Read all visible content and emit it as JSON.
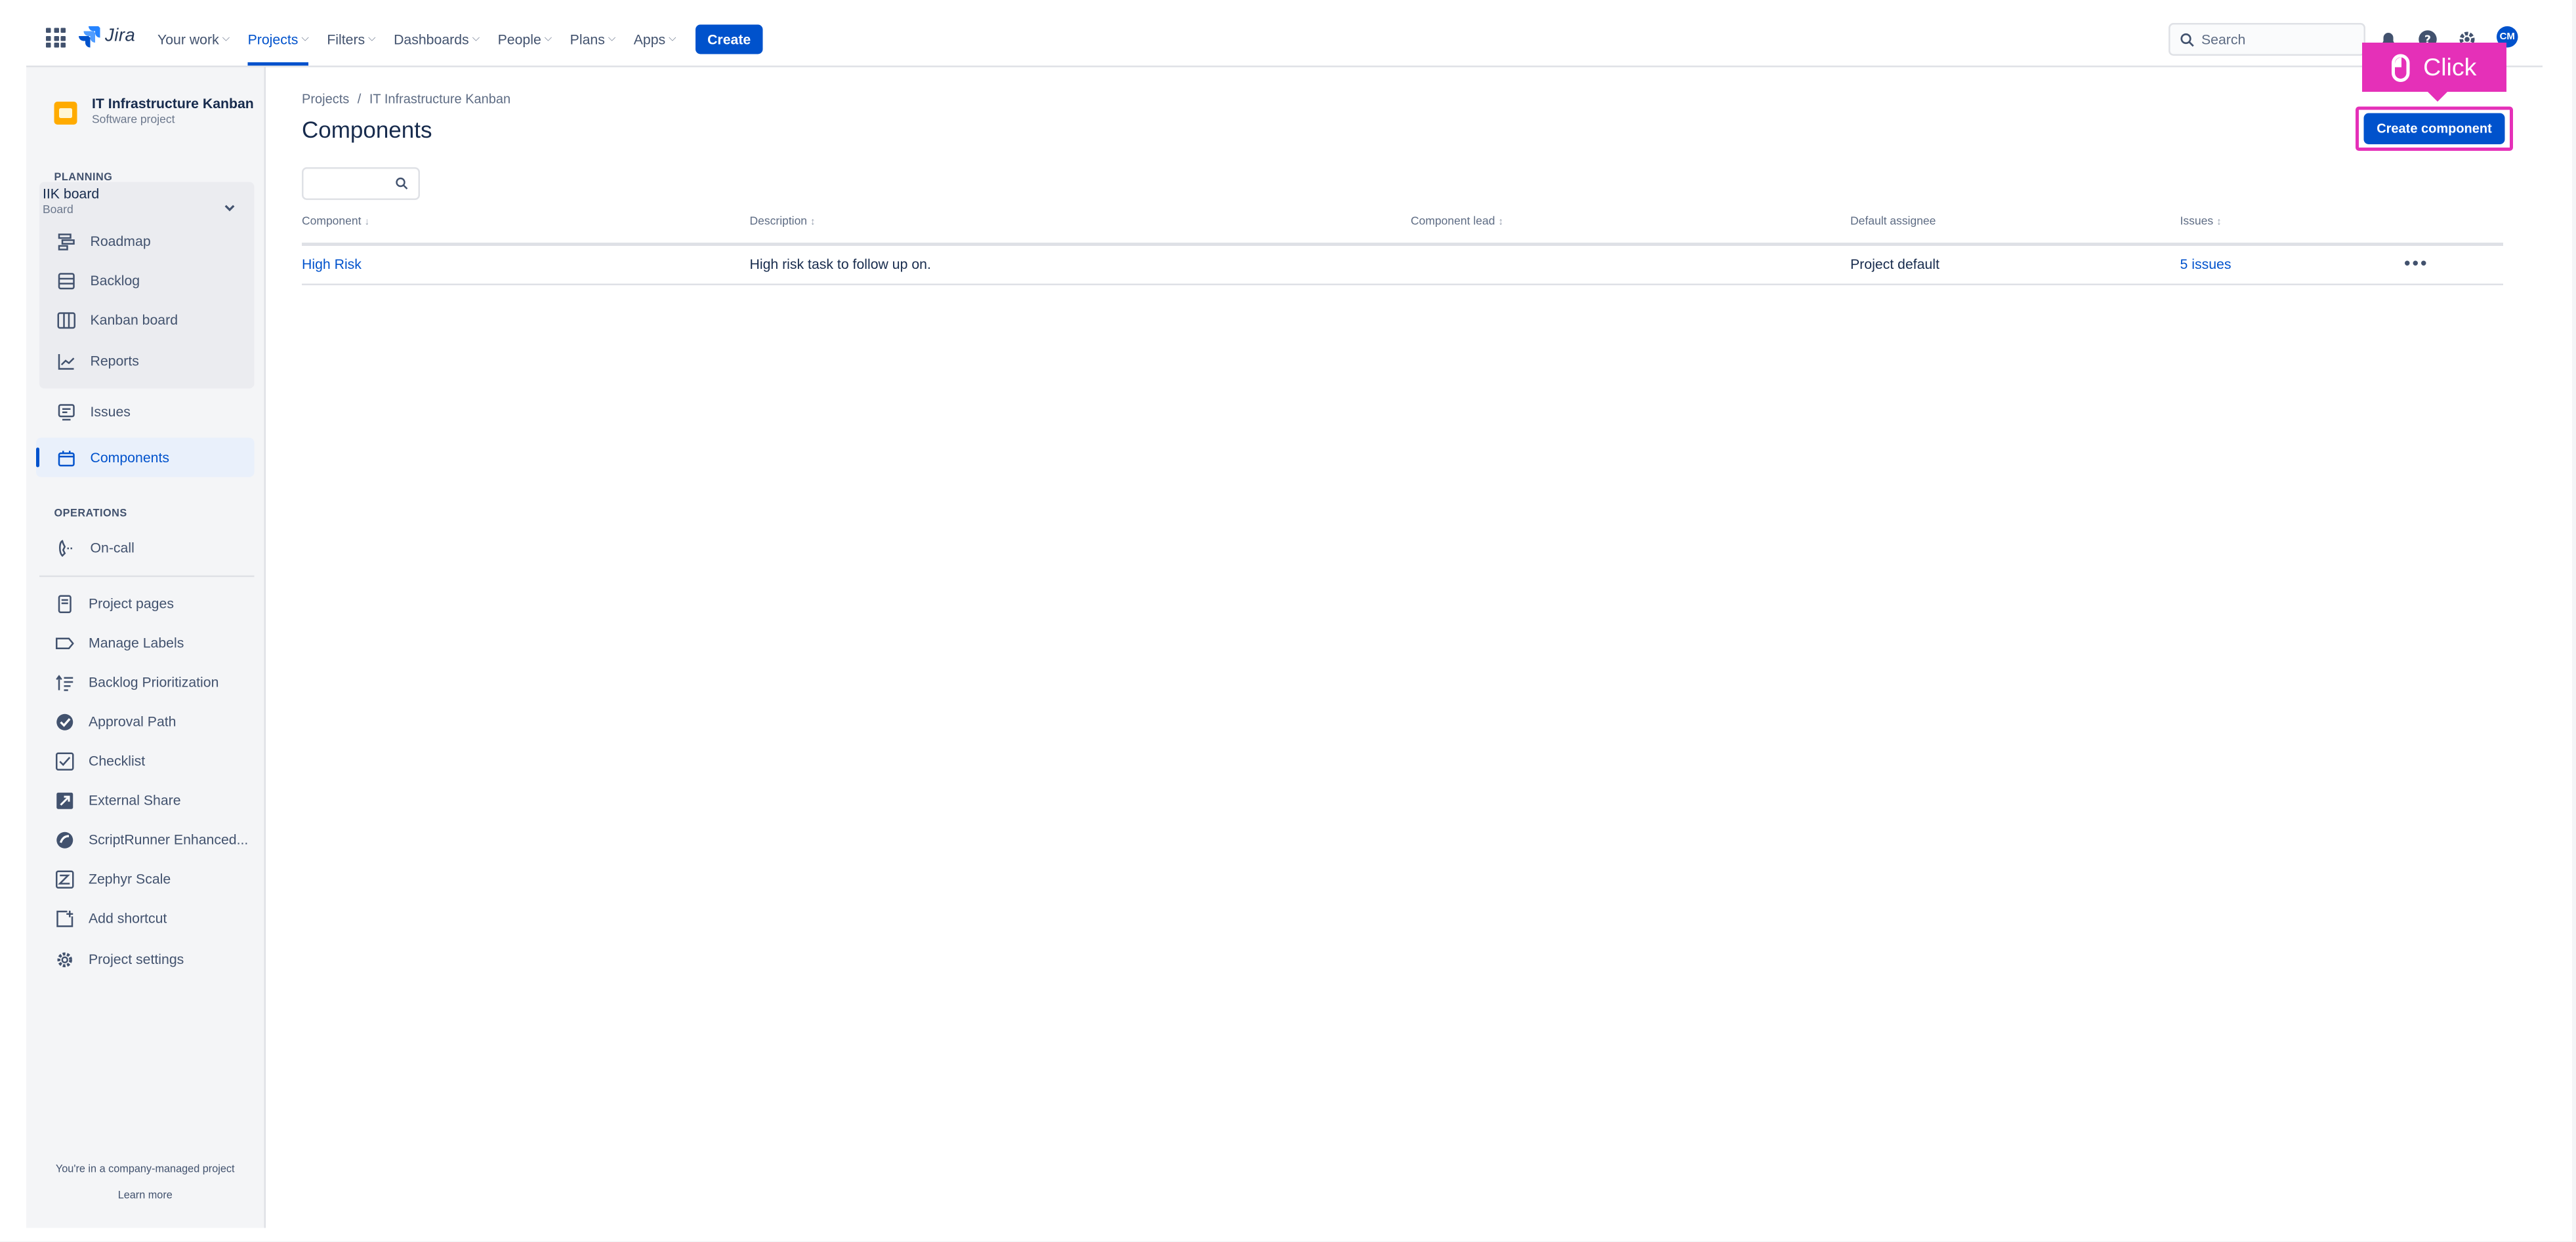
{
  "topnav": {
    "logo_text": "Jira",
    "items": [
      {
        "label": "Your work",
        "active": false
      },
      {
        "label": "Projects",
        "active": true
      },
      {
        "label": "Filters",
        "active": false
      },
      {
        "label": "Dashboards",
        "active": false
      },
      {
        "label": "People",
        "active": false
      },
      {
        "label": "Plans",
        "active": false
      },
      {
        "label": "Apps",
        "active": false
      }
    ],
    "create_label": "Create",
    "search_placeholder": "Search",
    "avatar_initials": "CM"
  },
  "sidebar": {
    "project_name": "IT Infrastructure Kanban",
    "project_type": "Software project",
    "planning_heading": "PLANNING",
    "board_name": "IIK board",
    "board_sub": "Board",
    "planning_items": [
      {
        "label": "Roadmap",
        "icon": "roadmap-icon"
      },
      {
        "label": "Backlog",
        "icon": "backlog-icon"
      },
      {
        "label": "Kanban board",
        "icon": "kanban-board-icon"
      },
      {
        "label": "Reports",
        "icon": "reports-icon"
      }
    ],
    "issues_label": "Issues",
    "components_label": "Components",
    "operations_heading": "OPERATIONS",
    "oncall_label": "On-call",
    "extra_items": [
      {
        "label": "Project pages",
        "icon": "project-pages-icon"
      },
      {
        "label": "Manage Labels",
        "icon": "label-icon"
      },
      {
        "label": "Backlog Prioritization",
        "icon": "prioritization-icon"
      },
      {
        "label": "Approval Path",
        "icon": "approval-path-icon"
      },
      {
        "label": "Checklist",
        "icon": "checklist-icon"
      },
      {
        "label": "External Share",
        "icon": "external-share-icon"
      },
      {
        "label": "ScriptRunner Enhanced...",
        "icon": "scriptrunner-icon"
      },
      {
        "label": "Zephyr Scale",
        "icon": "zephyr-scale-icon"
      },
      {
        "label": "Add shortcut",
        "icon": "add-shortcut-icon"
      },
      {
        "label": "Project settings",
        "icon": "gear-icon"
      }
    ],
    "footer_text": "You're in a company-managed project",
    "footer_link": "Learn more"
  },
  "main": {
    "breadcrumb": [
      "Projects",
      "IT Infrastructure Kanban"
    ],
    "title": "Components",
    "create_button": "Create component",
    "click_annotation": "Click",
    "columns": [
      "Component",
      "Description",
      "Component lead",
      "Default assignee",
      "Issues"
    ],
    "rows": [
      {
        "component": "High Risk",
        "description": "High risk task to follow up on.",
        "lead": "",
        "assignee": "Project default",
        "issues": "5 issues"
      }
    ]
  },
  "colors": {
    "brand": "#0052cc",
    "annotation": "#e530b8",
    "text": "#172b4d"
  }
}
